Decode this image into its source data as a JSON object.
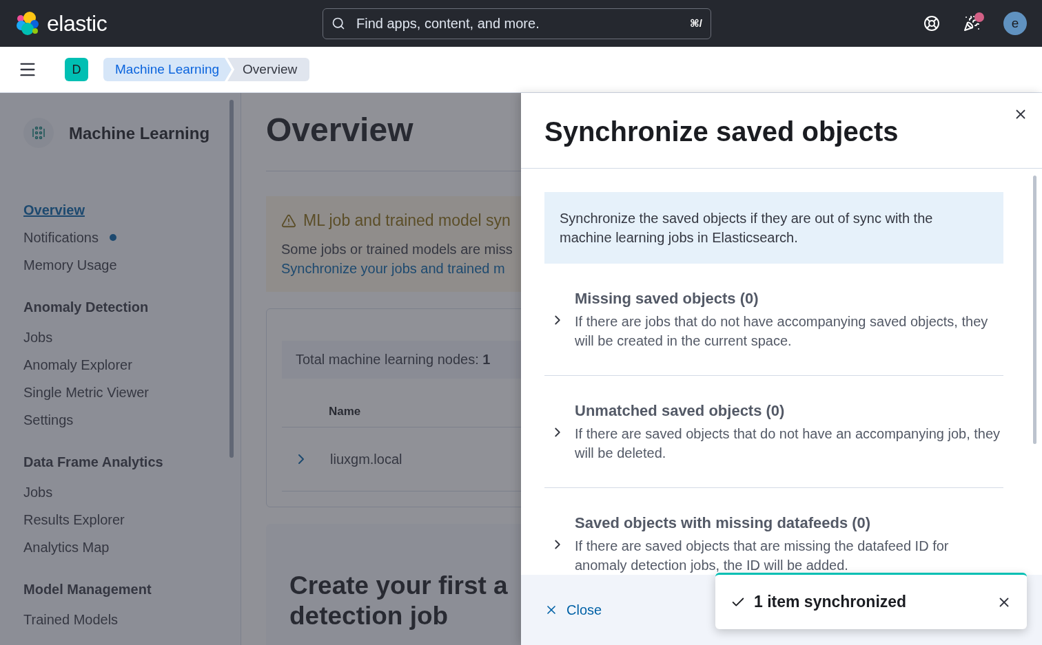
{
  "header": {
    "logo_text": "elastic",
    "search": {
      "placeholder": "Find apps, content, and more.",
      "shortcut": "⌘/"
    },
    "news_unread": true,
    "avatar": "e"
  },
  "breadcrumbs_bar": {
    "space": "D",
    "crumbs": [
      {
        "label": "Machine Learning",
        "selected": false
      },
      {
        "label": "Overview",
        "selected": true
      }
    ]
  },
  "sidebar": {
    "title": "Machine Learning",
    "sections": [
      {
        "items": [
          {
            "label": "Overview",
            "selected": true,
            "dot": false
          },
          {
            "label": "Notifications",
            "selected": false,
            "dot": true
          },
          {
            "label": "Memory Usage",
            "selected": false,
            "dot": false
          }
        ]
      },
      {
        "heading": "Anomaly Detection",
        "items": [
          {
            "label": "Jobs",
            "selected": false,
            "dot": false
          },
          {
            "label": "Anomaly Explorer",
            "selected": false,
            "dot": false
          },
          {
            "label": "Single Metric Viewer",
            "selected": false,
            "dot": false
          },
          {
            "label": "Settings",
            "selected": false,
            "dot": false
          }
        ]
      },
      {
        "heading": "Data Frame Analytics",
        "items": [
          {
            "label": "Jobs",
            "selected": false,
            "dot": false
          },
          {
            "label": "Results Explorer",
            "selected": false,
            "dot": false
          },
          {
            "label": "Analytics Map",
            "selected": false,
            "dot": false
          }
        ]
      },
      {
        "heading": "Model Management",
        "items": [
          {
            "label": "Trained Models",
            "selected": false,
            "dot": false
          }
        ]
      }
    ]
  },
  "main": {
    "title": "Overview",
    "callout": {
      "title": "ML job and trained model syn",
      "text": "Some jobs or trained models are miss",
      "link": "Synchronize your jobs and trained m"
    },
    "nodes_panel": {
      "total": "Total machine learning nodes: **1**",
      "columns": [
        "Name"
      ],
      "rows": [
        {
          "name": "liuxgm.local",
          "expanded": false
        }
      ]
    },
    "create_panel": {
      "title_lines": [
        "Create your first a",
        "detection job"
      ]
    }
  },
  "flyout": {
    "title": "Synchronize saved objects",
    "callout": "Synchronize the saved objects if they are out of sync with the machine learning jobs in Elasticsearch.",
    "accordions": [
      {
        "title": "Missing saved objects (0)",
        "description": "If there are jobs that do not have accompanying saved objects, they will be created in the current space.",
        "expanded": false
      },
      {
        "title": "Unmatched saved objects (0)",
        "description": "If there are saved objects that do not have an accompanying job, they will be deleted.",
        "expanded": false
      },
      {
        "title": "Saved objects with missing datafeeds (0)",
        "description": "If there are saved objects that are missing the datafeed ID for anomaly detection jobs, the ID will be added.",
        "expanded": false
      }
    ],
    "close_label": "Close"
  },
  "toast": {
    "kind": "success",
    "text": "1 item synchronized"
  }
}
